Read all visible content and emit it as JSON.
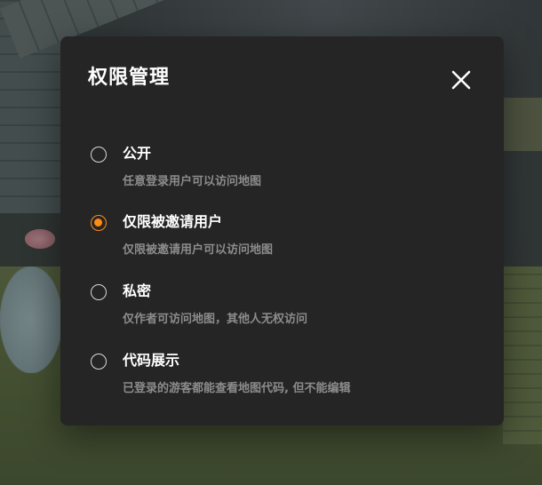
{
  "dialog": {
    "title": "权限管理",
    "close_icon": "close-icon"
  },
  "options": [
    {
      "label": "公开",
      "description": "任意登录用户可以访问地图",
      "selected": false
    },
    {
      "label": "仅限被邀请用户",
      "description": "仅限被邀请用户可以访问地图",
      "selected": true
    },
    {
      "label": "私密",
      "description": "仅作者可访问地图，其他人无权访问",
      "selected": false
    },
    {
      "label": "代码展示",
      "description": "已登录的游客都能查看地图代码, 但不能编辑",
      "selected": false
    }
  ],
  "colors": {
    "accent": "#ff8a16",
    "dialog_background": "#252525",
    "description_text": "#8c8c8c"
  }
}
